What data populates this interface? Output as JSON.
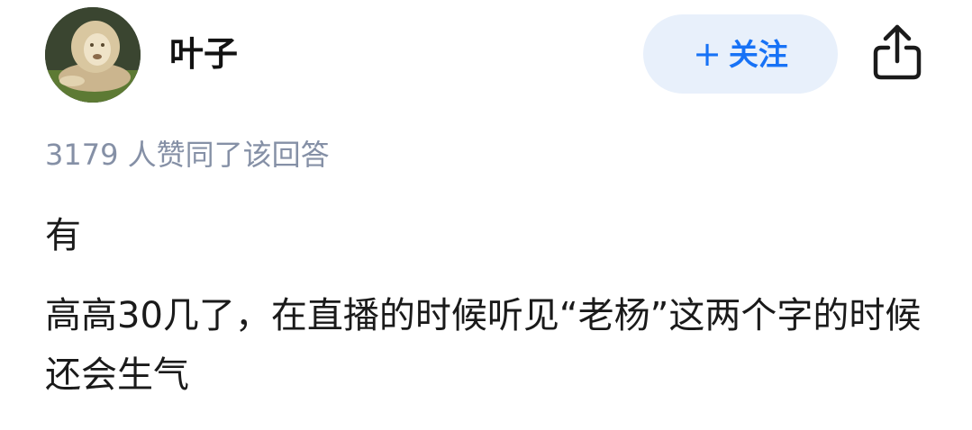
{
  "author": {
    "name": "叶子",
    "avatar_desc": "lion-avatar"
  },
  "follow_button": {
    "plus": "+",
    "label": "关注"
  },
  "share_icon": "share-icon",
  "upvote_text": "3179 人赞同了该回答",
  "answer": {
    "paragraphs": [
      "有",
      "高高30几了，在直播的时候听见“老杨”这两个字的时候还会生气"
    ]
  },
  "colors": {
    "accent": "#1772f6",
    "follow_bg": "#e8f0fb",
    "meta_gray": "#8590a6",
    "text": "#1a1a1a"
  }
}
